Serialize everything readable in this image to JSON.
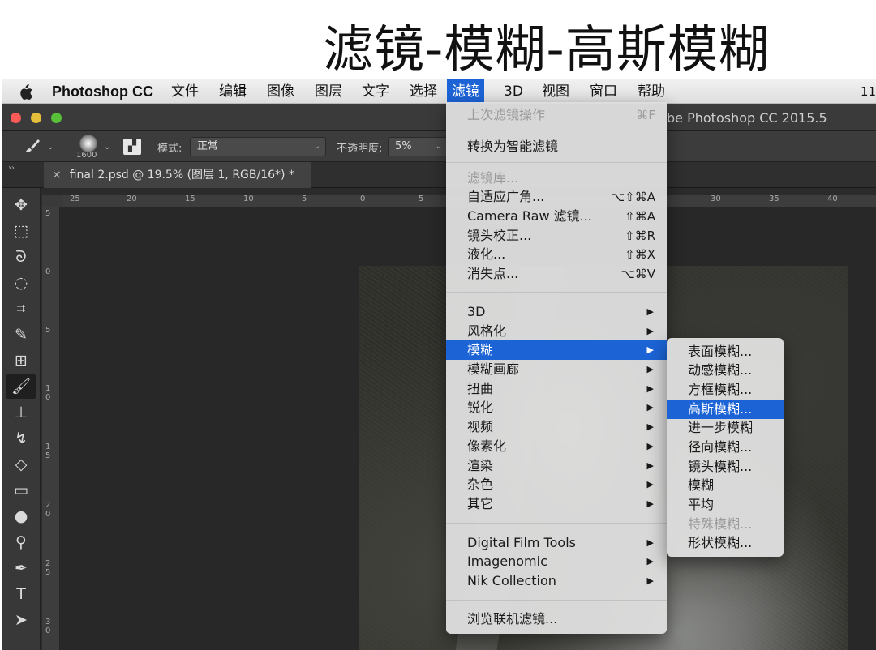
{
  "banner": {
    "title": "滤镜-模糊-高斯模糊"
  },
  "menubar": {
    "app_name": "Photoshop CC",
    "items": [
      "文件",
      "编辑",
      "图像",
      "图层",
      "文字",
      "选择",
      "滤镜",
      "3D",
      "视图",
      "窗口",
      "帮助"
    ],
    "active_item": "滤镜",
    "clock": "11"
  },
  "window": {
    "title": "be Photoshop CC 2015.5"
  },
  "options_bar": {
    "brush_size": "1600",
    "mode_label": "模式:",
    "mode_value": "正常",
    "opacity_label": "不透明度:",
    "opacity_value": "5%"
  },
  "document_tab": {
    "close": "×",
    "title": "final 2.psd @ 19.5% (图层 1, RGB/16*) *"
  },
  "ruler": {
    "top_ticks": [
      "25",
      "20",
      "15",
      "10",
      "5",
      "0",
      "5",
      "30",
      "35",
      "40"
    ],
    "left_ticks": [
      "5",
      "0",
      "5",
      "1 0",
      "1 5",
      "2 0",
      "2 5",
      "3 0"
    ]
  },
  "filter_menu": {
    "items": [
      {
        "label": "上次滤镜操作",
        "shortcut": "⌘F",
        "disabled": true
      },
      {
        "label": "转换为智能滤镜"
      },
      {
        "label": "滤镜库...",
        "disabled": true
      },
      {
        "label": "自适应广角...",
        "shortcut": "⌥⇧⌘A"
      },
      {
        "label": "Camera Raw 滤镜...",
        "shortcut": "⇧⌘A"
      },
      {
        "label": "镜头校正...",
        "shortcut": "⇧⌘R"
      },
      {
        "label": "液化...",
        "shortcut": "⇧⌘X"
      },
      {
        "label": "消失点...",
        "shortcut": "⌥⌘V"
      },
      {
        "label": "3D",
        "submenu": true
      },
      {
        "label": "风格化",
        "submenu": true
      },
      {
        "label": "模糊",
        "submenu": true,
        "highlighted": true
      },
      {
        "label": "模糊画廊",
        "submenu": true
      },
      {
        "label": "扭曲",
        "submenu": true
      },
      {
        "label": "锐化",
        "submenu": true
      },
      {
        "label": "视频",
        "submenu": true
      },
      {
        "label": "像素化",
        "submenu": true
      },
      {
        "label": "渲染",
        "submenu": true
      },
      {
        "label": "杂色",
        "submenu": true
      },
      {
        "label": "其它",
        "submenu": true
      },
      {
        "label": "Digital Film Tools",
        "submenu": true
      },
      {
        "label": "Imagenomic",
        "submenu": true
      },
      {
        "label": "Nik Collection",
        "submenu": true
      },
      {
        "label": "浏览联机滤镜..."
      }
    ],
    "arrow": "▶"
  },
  "blur_submenu": {
    "items": [
      {
        "label": "表面模糊..."
      },
      {
        "label": "动感模糊..."
      },
      {
        "label": "方框模糊..."
      },
      {
        "label": "高斯模糊...",
        "highlighted": true
      },
      {
        "label": "进一步模糊"
      },
      {
        "label": "径向模糊..."
      },
      {
        "label": "镜头模糊..."
      },
      {
        "label": "模糊"
      },
      {
        "label": "平均"
      },
      {
        "label": "特殊模糊...",
        "disabled": true
      },
      {
        "label": "形状模糊..."
      }
    ]
  },
  "colors": {
    "highlight": "#1c63d6",
    "ps_dark": "#2b2b2b"
  }
}
